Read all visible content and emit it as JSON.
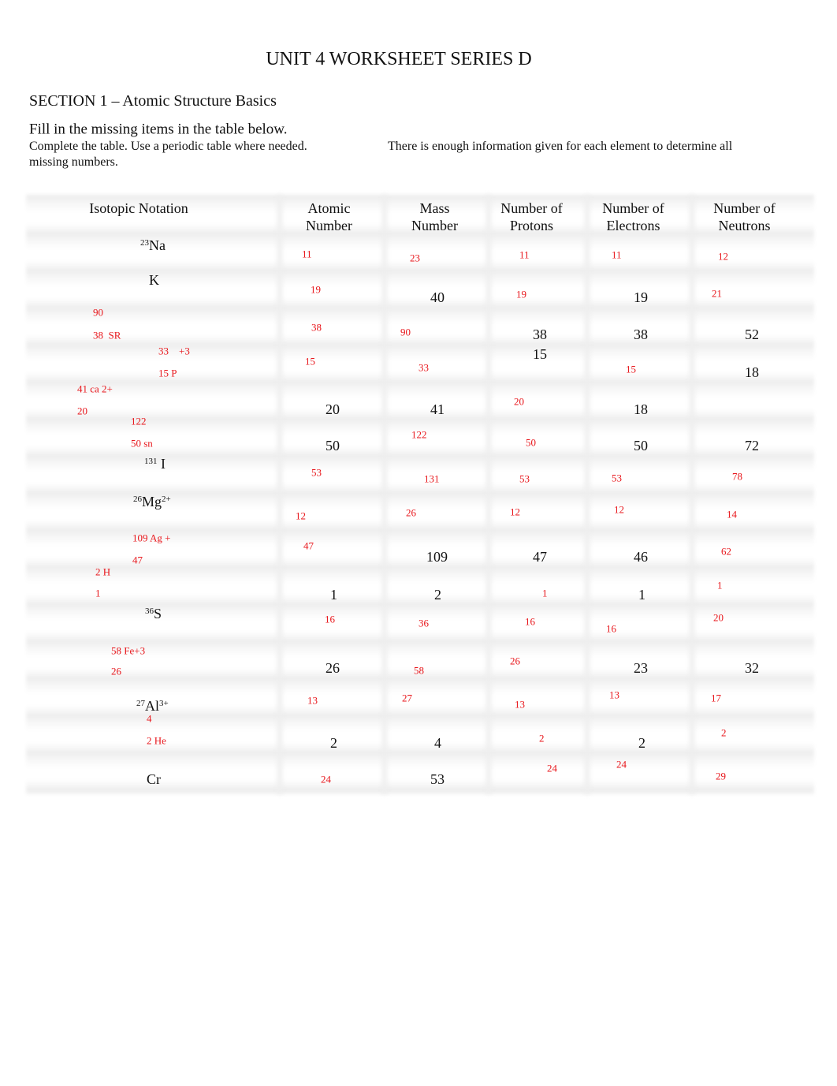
{
  "title": "UNIT 4 WORKSHEET SERIES D",
  "section": "SECTION 1 – Atomic Structure Basics",
  "instruction": "Fill in the missing items in the table below.",
  "note_left": "Complete the table. Use a periodic table where needed.",
  "note_right": "There is enough information given for each element to determine all",
  "note_cont": "missing numbers.",
  "colors": {
    "answer": "#e8161b",
    "text": "#111111"
  },
  "table": {
    "headers": [
      {
        "l1": "Isotopic Notation",
        "l2": ""
      },
      {
        "l1": "Atomic",
        "l2": "Number"
      },
      {
        "l1": "Mass",
        "l2": "Number"
      },
      {
        "l1": "Number of",
        "l2": "Protons"
      },
      {
        "l1": "Number of",
        "l2": "Electrons"
      },
      {
        "l1": "Number of",
        "l2": "Neutrons"
      }
    ],
    "notations": [
      {
        "mass": "23",
        "symbol": "Na",
        "charge": ""
      },
      {
        "mass": "",
        "symbol": "K",
        "charge": ""
      },
      {
        "mass": "131",
        "symbol": "I",
        "charge": ""
      },
      {
        "mass": "26",
        "symbol": "Mg",
        "charge": "2+"
      },
      {
        "mass": "36",
        "symbol": "S",
        "charge": ""
      },
      {
        "mass": "27",
        "symbol": "Al",
        "charge": "3+"
      },
      {
        "mass": "",
        "symbol": "Cr",
        "charge": ""
      }
    ],
    "given": [
      "40",
      "19",
      "38",
      "38",
      "52",
      "15",
      "18",
      "20",
      "41",
      "18",
      "50",
      "50",
      "72",
      "109",
      "47",
      "46",
      "1",
      "2",
      "1",
      "26",
      "23",
      "32",
      "2",
      "4",
      "2",
      "53"
    ],
    "answers": [
      "11",
      "23",
      "11",
      "11",
      "12",
      "19",
      "19",
      "21",
      "90",
      "38  SR",
      "38",
      "90",
      "33    +3",
      "15 P",
      "15",
      "33",
      "15",
      "41 ca 2+",
      "20",
      "20",
      "122",
      "50 sn",
      "122",
      "50",
      "53",
      "131",
      "53",
      "53",
      "78",
      "12",
      "26",
      "12",
      "12",
      "14",
      "109 Ag +",
      "47",
      "47",
      "62",
      "2 H",
      "1",
      "1",
      "1",
      "16",
      "36",
      "16",
      "16",
      "20",
      "58 Fe+3",
      "26",
      "58",
      "26",
      "13",
      "27",
      "13",
      "13",
      "17",
      "4",
      "2 He",
      "2",
      "2",
      "24",
      "24",
      "24",
      "29"
    ]
  }
}
